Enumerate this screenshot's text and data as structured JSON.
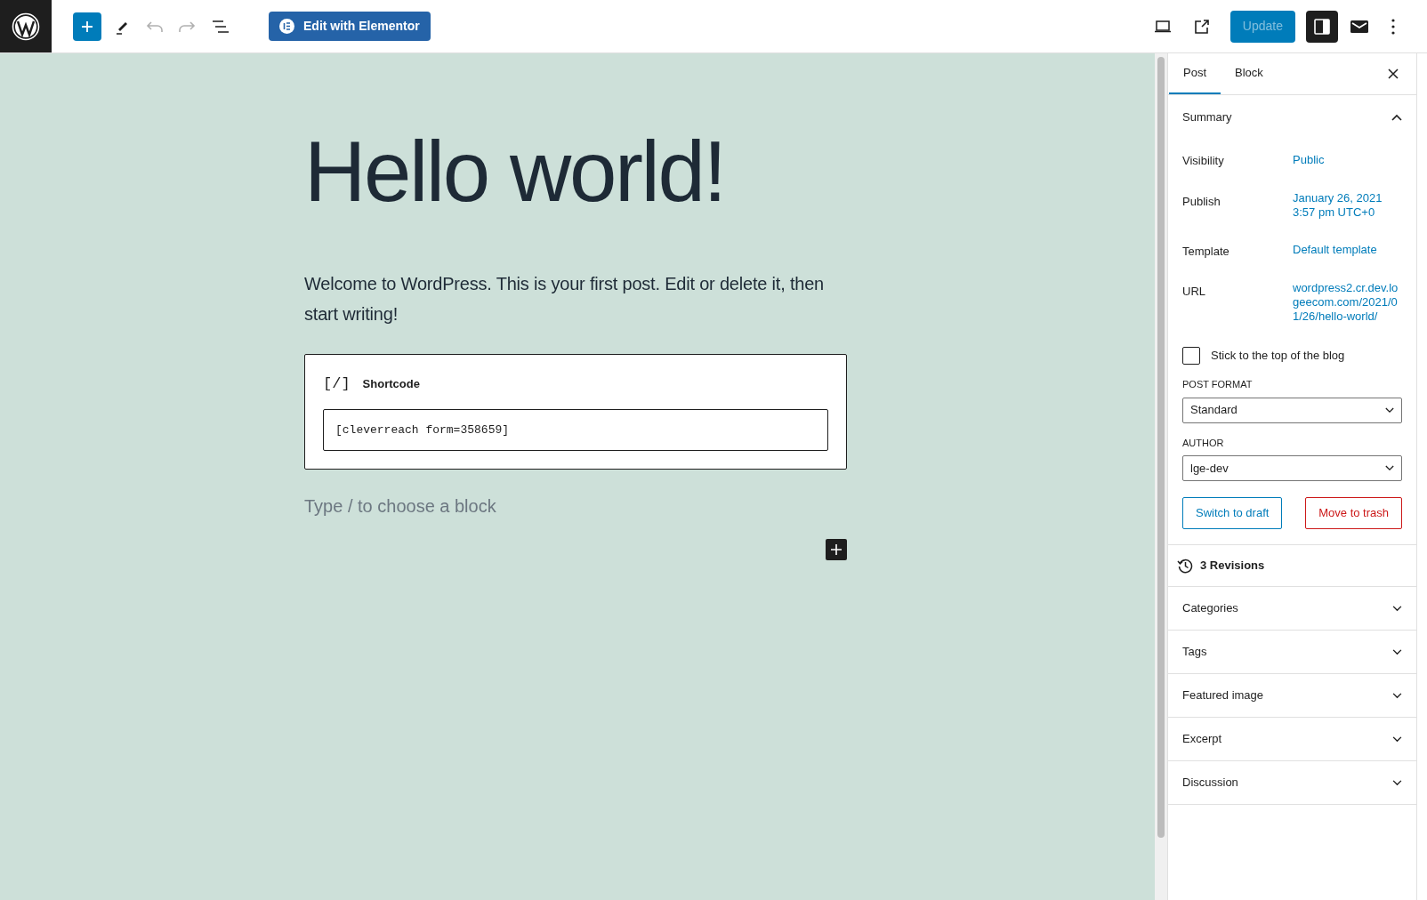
{
  "toolbar": {
    "undo_disabled": true,
    "redo_disabled": true,
    "elementor_button": "Edit with Elementor",
    "update_button": "Update",
    "update_disabled": true,
    "settings_active": true
  },
  "post": {
    "title": "Hello world!",
    "paragraph": "Welcome to WordPress. This is your first post. Edit or delete it, then start writing!",
    "shortcode": {
      "label": "Shortcode",
      "icon": "[/]",
      "value": "[cleverreach form=358659]"
    },
    "new_block_placeholder": "Type / to choose a block"
  },
  "sidebar": {
    "tabs": [
      {
        "label": "Post",
        "selected": true
      },
      {
        "label": "Block",
        "selected": false
      }
    ],
    "summary": {
      "title": "Summary",
      "expanded": true,
      "rows": [
        {
          "label": "Visibility",
          "value": "Public"
        },
        {
          "label": "Publish",
          "value": "January 26, 2021 3:57 pm UTC+0"
        },
        {
          "label": "Template",
          "value": "Default template"
        },
        {
          "label": "URL",
          "value": "wordpress2.cr.dev.logeecom.com/2021/01/26/hello-world/"
        }
      ],
      "sticky": {
        "label": "Stick to the top of the blog",
        "checked": false
      },
      "selects": [
        {
          "label": "POST FORMAT",
          "value": "Standard"
        },
        {
          "label": "AUTHOR",
          "value": "lge-dev"
        }
      ],
      "buttons": [
        {
          "label": "Switch to draft",
          "kind": "secondary"
        },
        {
          "label": "Move to trash",
          "kind": "destructive"
        }
      ]
    },
    "panels": [
      {
        "kind": "revisions",
        "title": "3 Revisions"
      },
      {
        "kind": "collapsible",
        "title": "Categories",
        "expanded": false
      },
      {
        "kind": "collapsible",
        "title": "Tags",
        "expanded": false
      },
      {
        "kind": "collapsible",
        "title": "Featured image",
        "expanded": false
      },
      {
        "kind": "collapsible",
        "title": "Excerpt",
        "expanded": false
      },
      {
        "kind": "collapsible",
        "title": "Discussion",
        "expanded": false
      }
    ]
  }
}
